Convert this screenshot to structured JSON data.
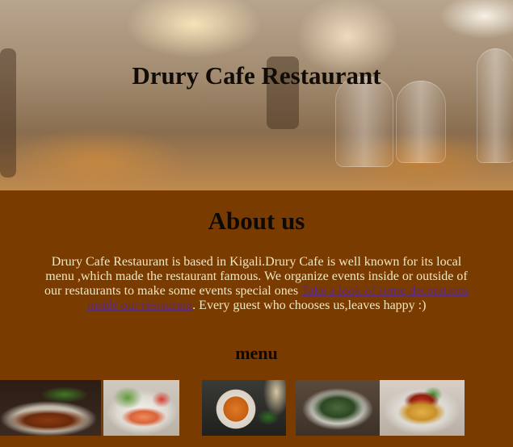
{
  "hero": {
    "title": "Drury Cafe Restaurant"
  },
  "about": {
    "title": "About us",
    "text_before_link": "Drury Cafe Restaurant is based in Kigali.Drury Cafe is well known for its local menu ,which made the restaurant famous. We organize events inside or outside of our restaurants to make some events special ones ",
    "link_label": "Take a look of some decorations inside our restaurant",
    "text_after_link": ". Every guest who chooses us,leaves happy :)"
  },
  "menu": {
    "title": "menu",
    "images": [
      "grilled-meat-platter",
      "salmon-salad-plate",
      "soup-bowl",
      "salad-bowl",
      "spaghetti-plate"
    ]
  },
  "colors": {
    "background": "#7a3b00",
    "link": "#5c2a80",
    "body_text": "#f3e7c2"
  }
}
